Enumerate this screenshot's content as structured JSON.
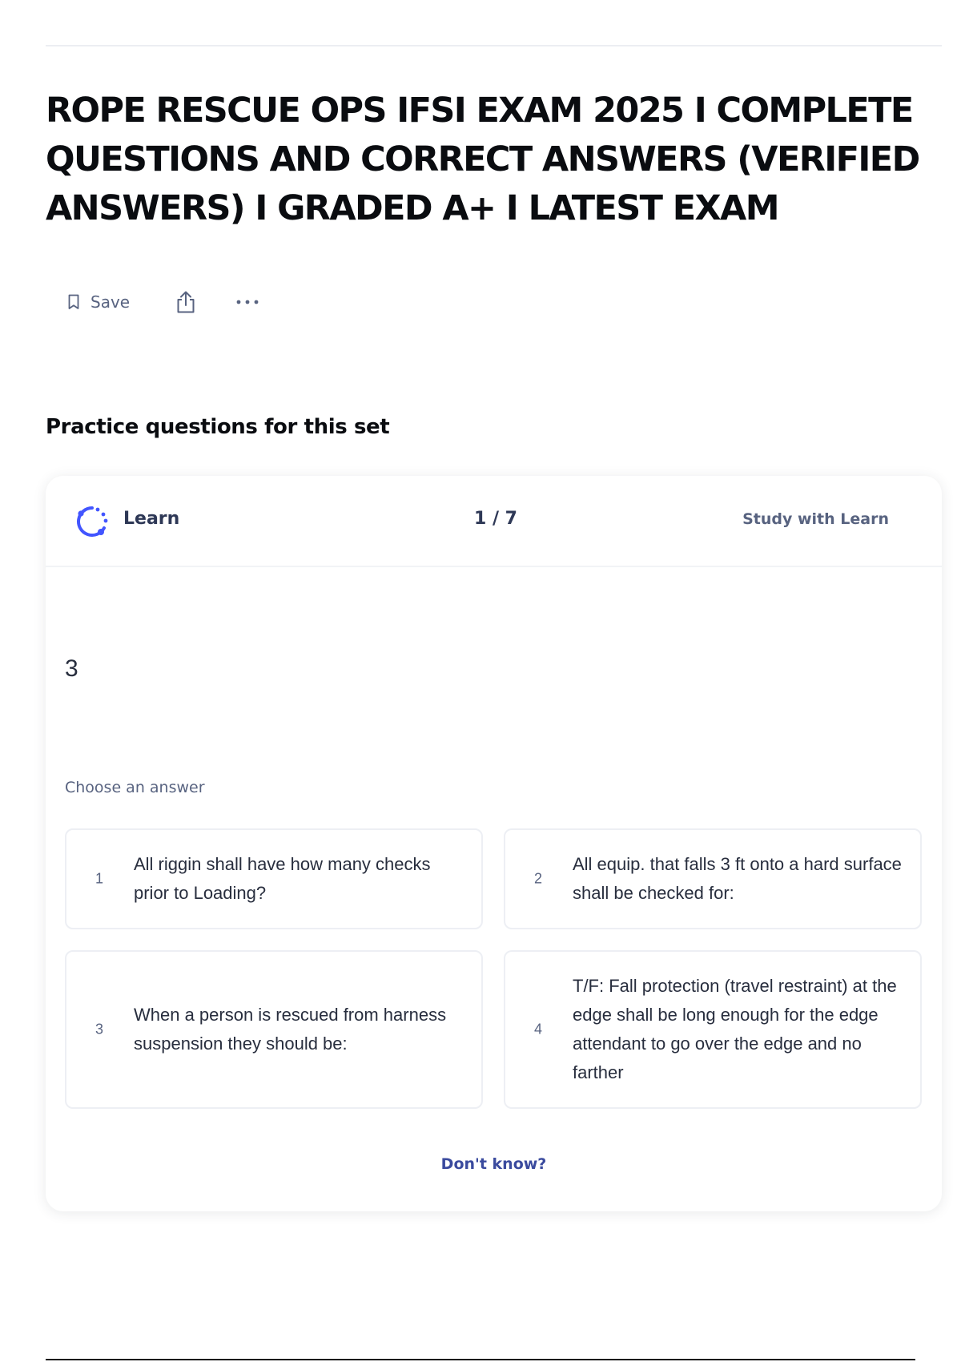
{
  "set": {
    "title": "ROPE RESCUE OPS IFSI EXAM 2025 I COMPLETE QUESTIONS AND CORRECT ANSWERS (VERIFIED ANSWERS) I GRADED A+ I LATEST EXAM"
  },
  "actions": {
    "save_label": "Save",
    "save_icon": "bookmark-icon",
    "share_icon": "share-icon",
    "more_icon": "more-horizontal-icon"
  },
  "practice": {
    "heading": "Practice questions for this set"
  },
  "card": {
    "mode_label": "Learn",
    "mode_icon": "learn-progress-icon",
    "progress": "1 / 7",
    "study_link": "Study with Learn",
    "term": "3",
    "prompt": "Choose an answer",
    "options": [
      {
        "number": "1",
        "text": "All riggin shall have how many checks prior to Loading?"
      },
      {
        "number": "2",
        "text": "All equip. that falls 3 ft onto a hard surface shall be checked for:"
      },
      {
        "number": "3",
        "text": "When a person is rescued from harness suspension they should be:"
      },
      {
        "number": "4",
        "text": "T/F: Fall protection (travel restraint) at the edge shall be long enough for the edge attendant to go over the edge and no farther"
      }
    ],
    "dont_know": "Don't know?"
  },
  "colors": {
    "title_text": "#0a0c10",
    "muted_text": "#586380",
    "accent_blue": "#4255ff",
    "link_blue": "#3a4a9e",
    "option_border": "#edeff4"
  }
}
